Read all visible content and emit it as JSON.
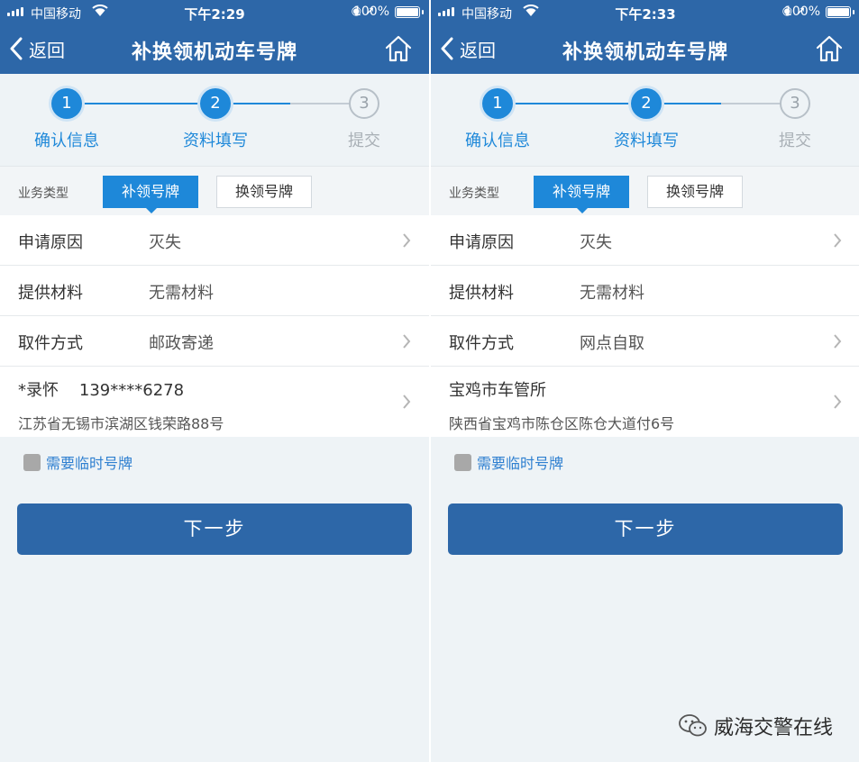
{
  "phones": [
    {
      "status": {
        "carrier": "中国移动",
        "time": "下午2:29",
        "battery": "100%"
      },
      "nav": {
        "back_label": "返回",
        "title": "补换领机动车号牌"
      },
      "steps": [
        {
          "num": "1",
          "label": "确认信息",
          "state": "active"
        },
        {
          "num": "2",
          "label": "资料填写",
          "state": "active"
        },
        {
          "num": "3",
          "label": "提交",
          "state": "inactive"
        }
      ],
      "business": {
        "label": "业务类型",
        "tab_selected": "补领号牌",
        "tab_other": "换领号牌"
      },
      "rows": [
        {
          "label": "申请原因",
          "value": "灭失"
        },
        {
          "label": "提供材料",
          "value": "无需材料"
        },
        {
          "label": "取件方式",
          "value": "邮政寄递"
        }
      ],
      "address": {
        "line1": "*录怀    139****6278",
        "line2": "江苏省无锡市滨湖区钱荣路88号"
      },
      "temp_plate_label": "需要临时号牌",
      "next_label": "下一步"
    },
    {
      "status": {
        "carrier": "中国移动",
        "time": "下午2:33",
        "battery": "100%"
      },
      "nav": {
        "back_label": "返回",
        "title": "补换领机动车号牌"
      },
      "steps": [
        {
          "num": "1",
          "label": "确认信息",
          "state": "active"
        },
        {
          "num": "2",
          "label": "资料填写",
          "state": "active"
        },
        {
          "num": "3",
          "label": "提交",
          "state": "inactive"
        }
      ],
      "business": {
        "label": "业务类型",
        "tab_selected": "补领号牌",
        "tab_other": "换领号牌"
      },
      "rows": [
        {
          "label": "申请原因",
          "value": "灭失"
        },
        {
          "label": "提供材料",
          "value": "无需材料"
        },
        {
          "label": "取件方式",
          "value": "网点自取"
        }
      ],
      "address": {
        "line1": "宝鸡市车管所",
        "line2": "陕西省宝鸡市陈仓区陈仓大道付6号"
      },
      "temp_plate_label": "需要临时号牌",
      "next_label": "下一步"
    }
  ],
  "watermark": "威海交警在线",
  "colors": {
    "header": "#2d67a8",
    "accent": "#1e88d9",
    "link": "#2e7fd0",
    "background": "#eef3f6"
  }
}
